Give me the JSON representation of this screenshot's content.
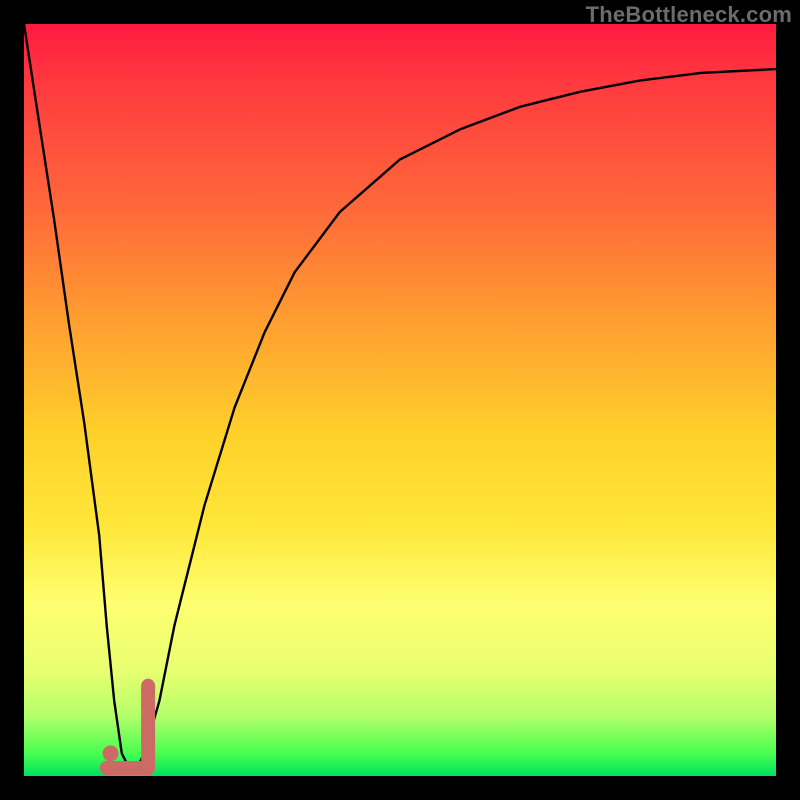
{
  "watermark": "TheBottleneck.com",
  "chart_data": {
    "type": "line",
    "title": "",
    "xlabel": "",
    "ylabel": "",
    "xlim": [
      0,
      100
    ],
    "ylim": [
      0,
      100
    ],
    "grid": false,
    "legend": false,
    "series": [
      {
        "name": "bottleneck-curve",
        "x": [
          0,
          2,
          4,
          6,
          8,
          10,
          11,
          12,
          13,
          14,
          15,
          16,
          18,
          20,
          24,
          28,
          32,
          36,
          42,
          50,
          58,
          66,
          74,
          82,
          90,
          100
        ],
        "y": [
          100,
          87,
          74,
          60,
          47,
          32,
          20,
          10,
          3,
          1,
          1,
          3,
          10,
          20,
          36,
          49,
          59,
          67,
          75,
          82,
          86,
          89,
          91,
          92.5,
          93.5,
          94
        ]
      }
    ],
    "marker": {
      "name": "selected-point",
      "color": "#cc6b66",
      "shape": "J-tick",
      "x_range": [
        11,
        16.5
      ],
      "y_range": [
        0,
        12
      ],
      "dot": {
        "x": 11.5,
        "y": 3
      }
    },
    "background_gradient": {
      "stops": [
        {
          "pos": 0.0,
          "color": "#ff1a3f"
        },
        {
          "pos": 0.25,
          "color": "#ff6a3a"
        },
        {
          "pos": 0.55,
          "color": "#ffd22a"
        },
        {
          "pos": 0.77,
          "color": "#ffff70"
        },
        {
          "pos": 0.92,
          "color": "#b4ff6a"
        },
        {
          "pos": 1.0,
          "color": "#00e060"
        }
      ]
    }
  }
}
